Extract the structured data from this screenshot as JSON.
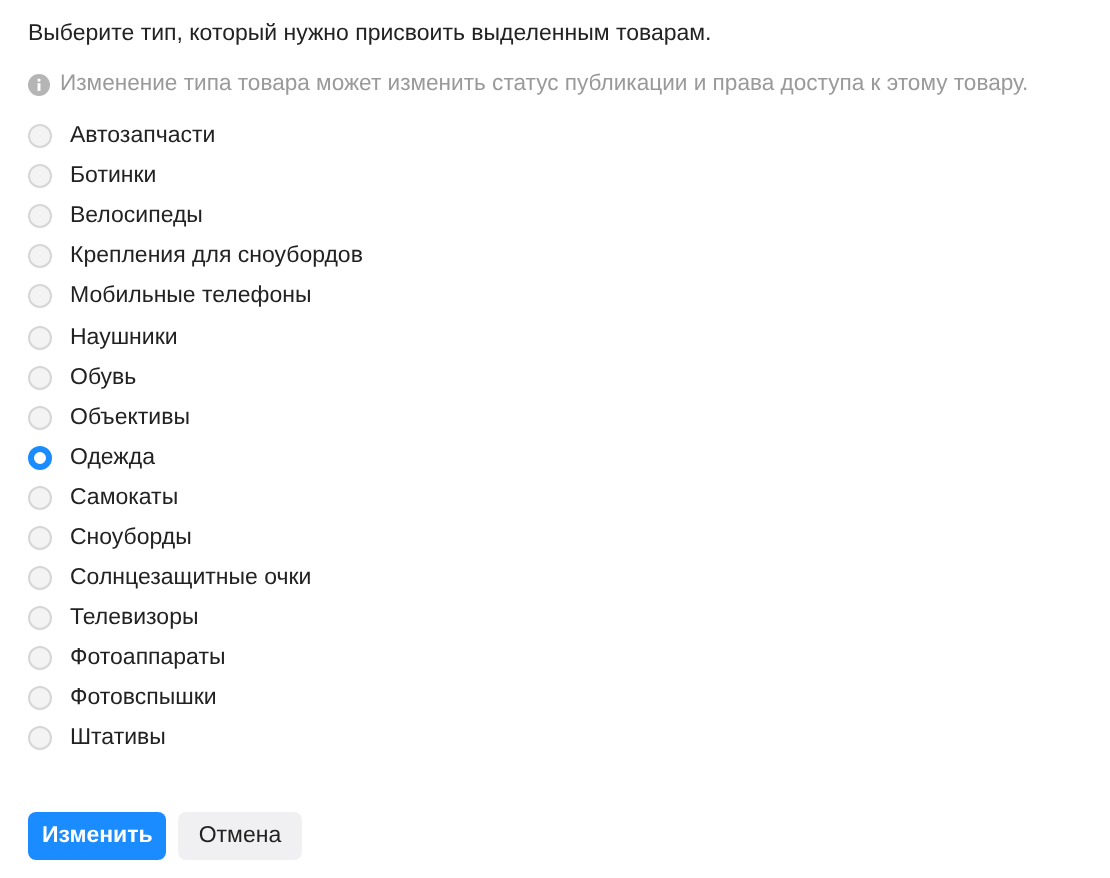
{
  "prompt": "Выберите тип, который нужно присвоить выделенным товарам.",
  "note": "Изменение типа товара может изменить статус публикации и права доступа к этому товару.",
  "options": [
    {
      "label": "Автозапчасти",
      "selected": false
    },
    {
      "label": "Ботинки",
      "selected": false
    },
    {
      "label": "Велосипеды",
      "selected": false
    },
    {
      "label": "Крепления для сноубордов",
      "selected": false
    },
    {
      "label": "Мобильные телефоны",
      "selected": false
    },
    {
      "label": "Наушники",
      "selected": false
    },
    {
      "label": "Обувь",
      "selected": false
    },
    {
      "label": "Объективы",
      "selected": false
    },
    {
      "label": "Одежда",
      "selected": true
    },
    {
      "label": "Самокаты",
      "selected": false
    },
    {
      "label": "Сноуборды",
      "selected": false
    },
    {
      "label": "Солнцезащитные очки",
      "selected": false
    },
    {
      "label": "Телевизоры",
      "selected": false
    },
    {
      "label": "Фотоаппараты",
      "selected": false
    },
    {
      "label": "Фотовспышки",
      "selected": false
    },
    {
      "label": "Штативы",
      "selected": false
    }
  ],
  "buttons": [
    {
      "label": "Изменить",
      "kind": "primary"
    },
    {
      "label": "Отмена",
      "kind": "secondary"
    }
  ]
}
